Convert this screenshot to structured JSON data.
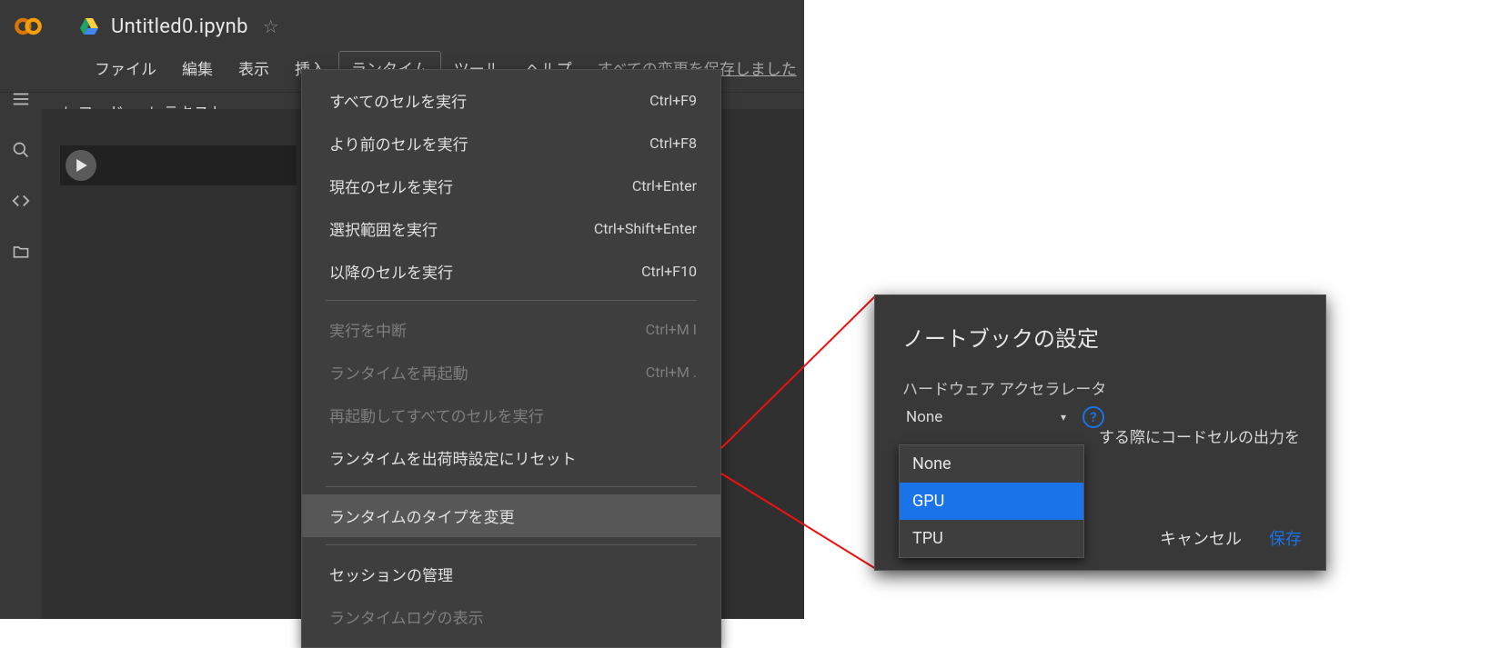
{
  "document": {
    "title": "Untitled0.ipynb"
  },
  "menubar": {
    "items": [
      "ファイル",
      "編集",
      "表示",
      "挿入",
      "ランタイム",
      "ツール",
      "ヘルプ"
    ],
    "save_status": "すべての変更を保存しました"
  },
  "toolbar": {
    "add_code": "＋ コード",
    "add_text": "＋ テキスト"
  },
  "runtime_menu": {
    "groups": [
      [
        {
          "label": "すべてのセルを実行",
          "shortcut": "Ctrl+F9",
          "disabled": false
        },
        {
          "label": "より前のセルを実行",
          "shortcut": "Ctrl+F8",
          "disabled": false
        },
        {
          "label": "現在のセルを実行",
          "shortcut": "Ctrl+Enter",
          "disabled": false
        },
        {
          "label": "選択範囲を実行",
          "shortcut": "Ctrl+Shift+Enter",
          "disabled": false
        },
        {
          "label": "以降のセルを実行",
          "shortcut": "Ctrl+F10",
          "disabled": false
        }
      ],
      [
        {
          "label": "実行を中断",
          "shortcut": "Ctrl+M I",
          "disabled": true
        },
        {
          "label": "ランタイムを再起動",
          "shortcut": "Ctrl+M .",
          "disabled": true
        },
        {
          "label": "再起動してすべてのセルを実行",
          "shortcut": "",
          "disabled": true
        },
        {
          "label": "ランタイムを出荷時設定にリセット",
          "shortcut": "",
          "disabled": false
        }
      ],
      [
        {
          "label": "ランタイムのタイプを変更",
          "shortcut": "",
          "disabled": false,
          "highlighted": true
        }
      ],
      [
        {
          "label": "セッションの管理",
          "shortcut": "",
          "disabled": false
        },
        {
          "label": "ランタイムログの表示",
          "shortcut": "",
          "disabled": true
        }
      ]
    ]
  },
  "dialog": {
    "title": "ノートブックの設定",
    "field_label": "ハードウェア アクセラレータ",
    "selected": "None",
    "hint": "する際にコードセルの出力を",
    "options": [
      "None",
      "GPU",
      "TPU"
    ],
    "selected_option_index": 1,
    "cancel": "キャンセル",
    "save": "保存"
  }
}
